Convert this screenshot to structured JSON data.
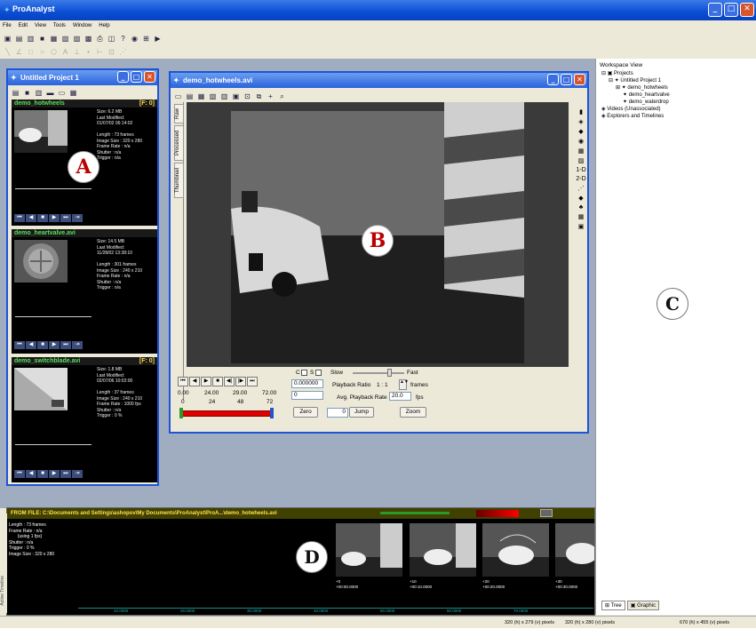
{
  "app": {
    "title": "ProAnalyst"
  },
  "menu": [
    "File",
    "Edit",
    "View",
    "Tools",
    "Window",
    "Help"
  ],
  "project_window": {
    "title": "Untitled Project 1",
    "cards": [
      {
        "name": "demo_hotwheels",
        "frame": "[F: 0]",
        "info": "Size: 6.2 MB\nLast Modified:\n01/07/02 06:14:02\n\nLength : 73 frames\nImage Size : 320 x 280\nFrame Rate : n/a\nShutter : n/a\nTrigger : n/a"
      },
      {
        "name": "demo_heartvalve.avi",
        "frame": "",
        "info": "Size: 14.5 MB\nLast Modified:\n11/28/02 13:38:10\n\nLength : 301 frames\nImage Size : 240 x 210\nFrame Rate : n/a\nShutter : n/a\nTrigger : n/a"
      },
      {
        "name": "demo_switchblade.avi",
        "frame": "[F: 0]",
        "info": "Size: 1.8 MB\nLast Modified:\n02/07/06 10:02:00\n\nLength : 37 frames\nImage Size : 240 x 210\nFrame Rate : 1000 fps\nShutter : n/a\nTrigger : 0 %"
      }
    ]
  },
  "video_window": {
    "title": "demo_hotwheels.avi",
    "side_tabs": [
      "Raw",
      "Processed",
      "Thumbnail"
    ],
    "right_tools": [
      "1-D",
      "2-D"
    ],
    "times": [
      "0.00",
      "24.00",
      "29.00",
      "72.00"
    ],
    "frames": [
      "0",
      "24",
      "48",
      "72"
    ],
    "time_field": "0.000000",
    "frame_field": "0",
    "cs_labels": [
      "C",
      "S"
    ],
    "slow": "Slow",
    "fast": "Fast",
    "ratio_label": "Playback Ratio",
    "ratio_value": "1 : 1",
    "ratio_unit": "frames",
    "avg_label": "Avg. Playback Rate",
    "avg_value": "20.0",
    "avg_unit": "fps",
    "zero": "Zero",
    "jump_value": "0",
    "jump": "Jump",
    "zoom": "Zoom"
  },
  "workspace": {
    "title": "Workspace View",
    "tree": [
      "Projects",
      "Untitled Project 1",
      "demo_hotwheels",
      "demo_heartvalve",
      "demo_waterdrop",
      "Videos (Unassociated)",
      "Explorers and Timelines"
    ],
    "tabs": [
      "Tree",
      "Graphic"
    ]
  },
  "timeline": {
    "header": "FROM FILE: C:\\Documents and Settings\\ashopov\\My Documents\\ProAnalyst\\ProA...\\demo_hotwheels.avi",
    "info": "Length : 73 frames\nFrame Rate : n/a\n       (using 1 fps)\nShutter : n/a\nTrigger : 0 %\nImage Size : 320 x 280",
    "side_label": "Active Timeline",
    "frames": [
      {
        "label": "+0\n+00:00.0000"
      },
      {
        "label": "+10\n+00:10.0000"
      },
      {
        "label": "+20\n+00:20.0000"
      },
      {
        "label": "+30\n+00:30.0000"
      }
    ],
    "ticks": [
      "10.0000",
      "20.0000",
      "30.0000",
      "40.0000",
      "50.0000",
      "60.0000",
      "70.0000"
    ]
  },
  "status": [
    "320 (h) x 279 (v) pixels",
    "320 (h) x 280 (v) pixels",
    "670 (h) x 455 (v) pixels"
  ],
  "callouts": [
    "A",
    "B",
    "C",
    "D"
  ]
}
